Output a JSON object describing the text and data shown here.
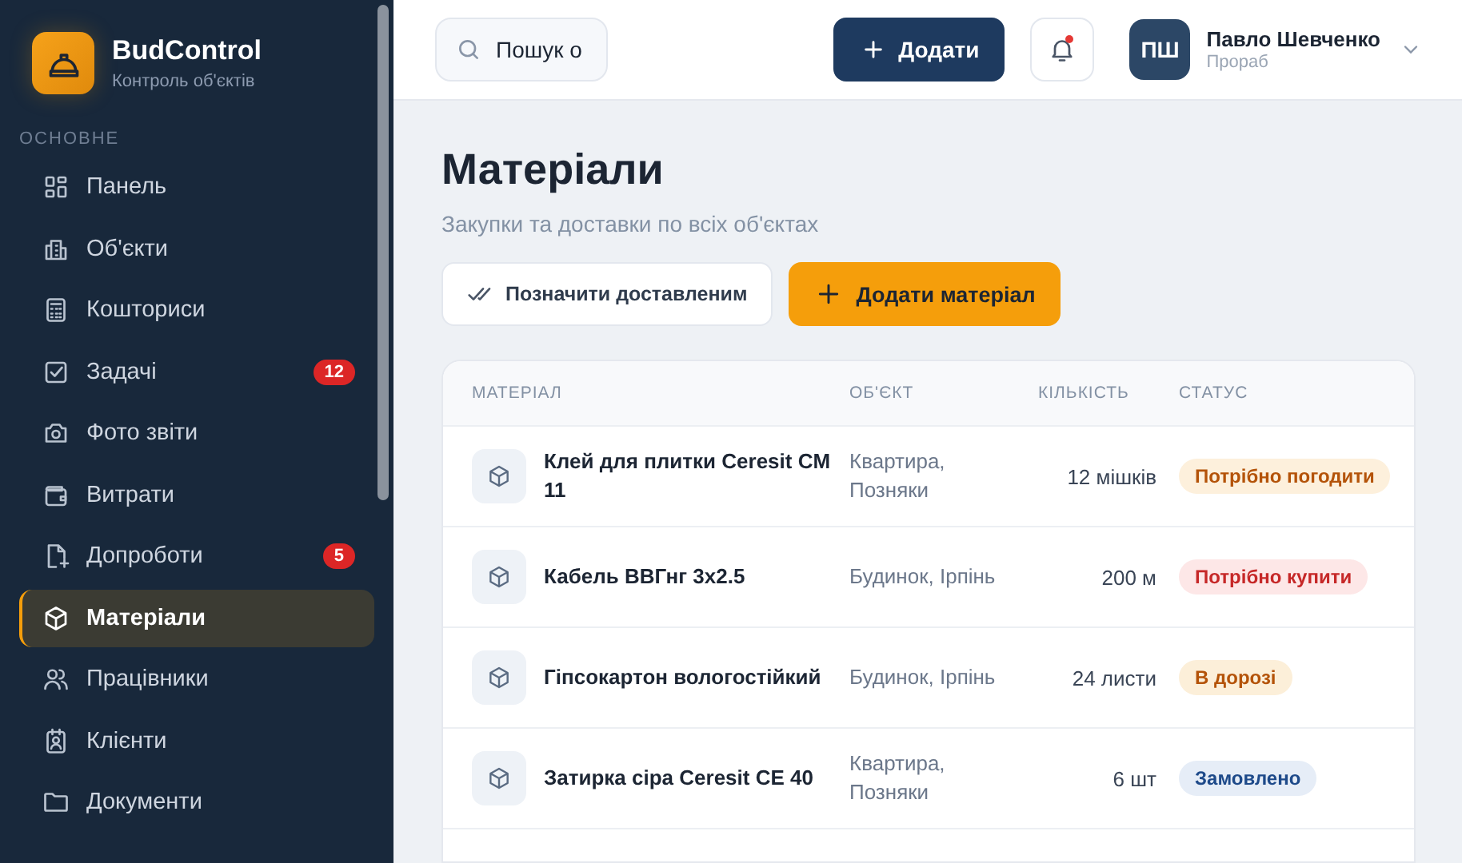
{
  "brand": {
    "name": "BudControl",
    "tagline": "Контроль об'єктів"
  },
  "sidebar": {
    "section": "ОСНОВНЕ",
    "items": [
      {
        "label": "Панель",
        "selected": false
      },
      {
        "label": "Об'єкти",
        "selected": false
      },
      {
        "label": "Кошториси",
        "selected": false
      },
      {
        "label": "Задачі",
        "selected": false,
        "badge": "12"
      },
      {
        "label": "Фото звіти",
        "selected": false
      },
      {
        "label": "Витрати",
        "selected": false
      },
      {
        "label": "Допроботи",
        "selected": false,
        "badge": "5"
      },
      {
        "label": "Матеріали",
        "selected": true
      },
      {
        "label": "Працівники",
        "selected": false
      },
      {
        "label": "Клієнти",
        "selected": false
      },
      {
        "label": "Документи",
        "selected": false
      }
    ]
  },
  "topbar": {
    "search": {
      "value": "Пошук о"
    },
    "add_button": "Додати",
    "notification_dot": true,
    "user": {
      "initials": "ПШ",
      "name": "Павло Шевченко",
      "role": "Прораб"
    }
  },
  "page": {
    "title": "Матеріали",
    "subtitle": "Закупки та доставки по всіх об'єктах",
    "actions": [
      "Позначити доставленим",
      "Додати матеріал"
    ]
  },
  "table": {
    "columns": [
      "МАТЕРІАЛ",
      "ОБ'ЄКТ",
      "КІЛЬКІСТЬ",
      "СТАТУС"
    ],
    "rows": [
      {
        "material": "Клей для плитки Ceresit CM 11",
        "object": "Квартира, Позняки",
        "quantity": "12 мішків",
        "status": {
          "label": "Потрібно погодити",
          "kind": "approve"
        }
      },
      {
        "material": "Кабель ВВГнг 3х2.5",
        "object": "Будинок, Ірпінь",
        "quantity": "200 м",
        "status": {
          "label": "Потрібно купити",
          "kind": "buy"
        }
      },
      {
        "material": "Гіпсокартон вологостійкий",
        "object": "Будинок, Ірпінь",
        "quantity": "24 листи",
        "status": {
          "label": "В дорозі",
          "kind": "transit"
        }
      },
      {
        "material": "Затирка сіра Ceresit CE 40",
        "object": "Квартира, Позняки",
        "quantity": "6 шт",
        "status": {
          "label": "Замовлено",
          "kind": "ordered"
        }
      }
    ]
  }
}
